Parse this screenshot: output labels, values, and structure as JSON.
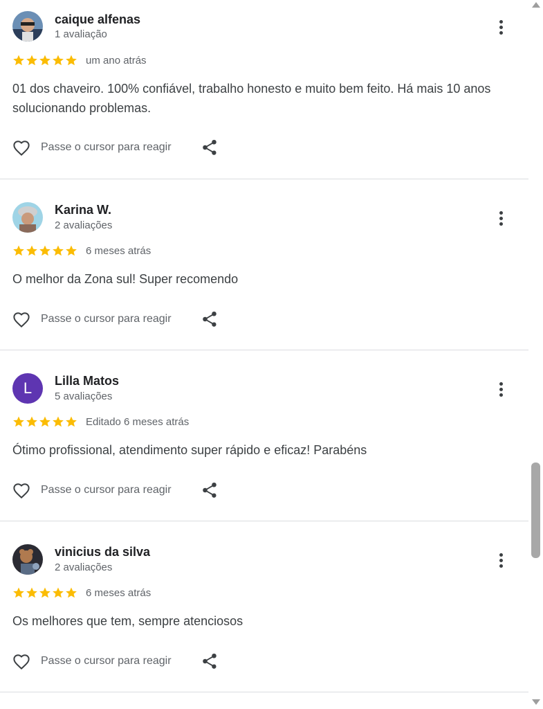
{
  "reviews": [
    {
      "name": "caique alfenas",
      "review_count": "1 avaliação",
      "stars": 5,
      "date": "um ano atrás",
      "text": "01 dos chaveiro. 100% confiável, trabalho honesto e muito bem feito. Há mais 10 anos solucionando problemas.",
      "react_label": "Passe o cursor para reagir"
    },
    {
      "name": "Karina W.",
      "review_count": "2 avaliações",
      "stars": 5,
      "date": "6 meses atrás",
      "text": "O melhor da Zona sul! Super recomendo",
      "react_label": "Passe o cursor para reagir"
    },
    {
      "name": "Lilla Matos",
      "avatar_initial": "L",
      "avatar_color": "#5e35b1",
      "review_count": "5 avaliações",
      "stars": 5,
      "date": "Editado 6 meses atrás",
      "text": "Ótimo profissional, atendimento super rápido e eficaz! Parabéns",
      "react_label": "Passe o cursor para reagir"
    },
    {
      "name": "vinicius da silva",
      "review_count": "2 avaliações",
      "stars": 5,
      "date": "6 meses atrás",
      "text": "Os melhores que tem, sempre atenciosos",
      "react_label": "Passe o cursor para reagir"
    }
  ],
  "colors": {
    "star": "#fbbc04",
    "divider": "#dadce0",
    "secondary_text": "#5f6368"
  },
  "icons": {
    "more": "three-dots-vertical-icon",
    "react": "heart-outline-icon",
    "share": "share-icon"
  }
}
